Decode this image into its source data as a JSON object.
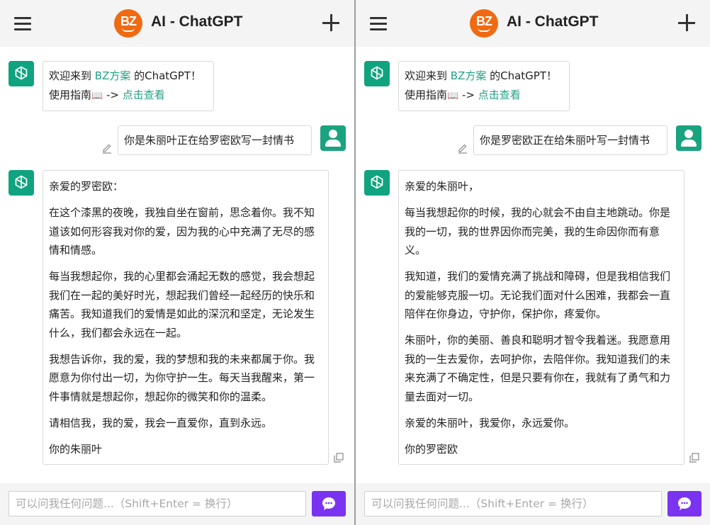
{
  "colors": {
    "accent": "#21a087",
    "send_button": "#7b33f2",
    "logo": "#f06a12",
    "avatar": "#10a37f"
  },
  "icons": {
    "menu": "hamburger-icon",
    "new_chat": "plus-icon",
    "bot_avatar": "openai-logo-icon",
    "user_avatar": "user-icon",
    "edit": "pencil-icon",
    "copy": "copy-icon",
    "guide": "book-icon",
    "send": "chat-bubble-icon"
  },
  "panes": [
    {
      "header": {
        "logo_text": "BZ",
        "title": "AI - ChatGPT"
      },
      "welcome": {
        "prefix": "欢迎来到 ",
        "brand": "BZ方案",
        "suffix": " 的ChatGPT！",
        "guide_prefix": "使用指南",
        "book": "📖",
        "arrow": " -> ",
        "guide_link": "点击查看"
      },
      "user_message": "你是朱丽叶正在给罗密欧写一封情书",
      "reply": {
        "paragraphs": [
          "亲爱的罗密欧：",
          "在这个漆黑的夜晚，我独自坐在窗前，思念着你。我不知道该如何形容我对你的爱，因为我的心中充满了无尽的感情和情感。",
          "每当我想起你，我的心里都会涌起无数的感觉，我会想起我们在一起的美好时光，想起我们曾经一起经历的快乐和痛苦。我知道我们的爱情是如此的深沉和坚定，无论发生什么，我们都会永远在一起。",
          "我想告诉你，我的爱，我的梦想和我的未来都属于你。我愿意为你付出一切，为你守护一生。每天当我醒来，第一件事情就是想起你，想起你的微笑和你的温柔。",
          "请相信我，我的爱，我会一直爱你，直到永远。",
          "你的朱丽叶"
        ]
      },
      "input": {
        "placeholder": "可以问我任何问题...（Shift+Enter = 换行）",
        "value": ""
      }
    },
    {
      "header": {
        "logo_text": "BZ",
        "title": "AI - ChatGPT"
      },
      "welcome": {
        "prefix": "欢迎来到 ",
        "brand": "BZ方案",
        "suffix": " 的ChatGPT！",
        "guide_prefix": "使用指南",
        "book": "📖",
        "arrow": " -> ",
        "guide_link": "点击查看"
      },
      "user_message": "你是罗密欧正在给朱丽叶写一封情书",
      "reply": {
        "paragraphs": [
          "亲爱的朱丽叶，",
          "每当我想起你的时候，我的心就会不由自主地跳动。你是我的一切，我的世界因你而完美，我的生命因你而有意义。",
          "我知道，我们的爱情充满了挑战和障碍，但是我相信我们的爱能够克服一切。无论我们面对什么困难，我都会一直陪伴在你身边，守护你，保护你，疼爱你。",
          "朱丽叶，你的美丽、善良和聪明才智令我着迷。我愿意用我的一生去爱你，去呵护你，去陪伴你。我知道我们的未来充满了不确定性，但是只要有你在，我就有了勇气和力量去面对一切。",
          "亲爱的朱丽叶，我爱你，永远爱你。",
          "你的罗密欧"
        ]
      },
      "input": {
        "placeholder": "可以问我任何问题...（Shift+Enter = 换行）",
        "value": ""
      }
    }
  ]
}
